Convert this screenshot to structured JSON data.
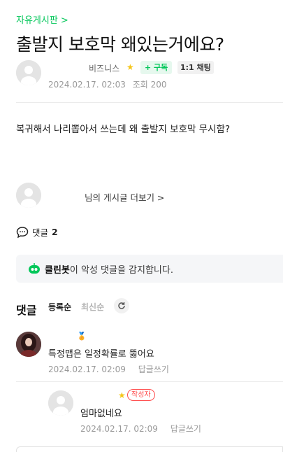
{
  "header": {
    "cafe_link": "자유게시판 >",
    "title": "출발지 보호막 왜있는거에요?"
  },
  "author": {
    "name": "비즈니스",
    "subscribe_label": "+ 구독",
    "chat_label": "1:1 채팅",
    "date": "2024.02.17. 02:03",
    "views": "조회 200"
  },
  "post": {
    "body": "복귀해서 나리뽑아서 쓰는데 왜 출발지 보호막 무시함?"
  },
  "more_posts": {
    "label": "님의 게시글 더보기 >"
  },
  "comment_summary": {
    "label": "댓글",
    "count": "2"
  },
  "cleanbot": {
    "name": "클린봇",
    "message": "이 악성 댓글을 감지합니다."
  },
  "comments_section": {
    "heading": "댓글",
    "sort_registered": "등록순",
    "sort_latest": "최신순"
  },
  "comments": [
    {
      "text": "특정맵은 일정확률로 뚫어요",
      "date": "2024.02.17. 02:09",
      "reply_label": "답글쓰기"
    },
    {
      "badge": "작성자",
      "text": "엄마없네요",
      "date": "2024.02.17. 02:09",
      "reply_label": "답글쓰기"
    }
  ],
  "colors": {
    "accent": "#03c75a",
    "writer_badge": "#ff4d4d",
    "muted": "#999999"
  }
}
